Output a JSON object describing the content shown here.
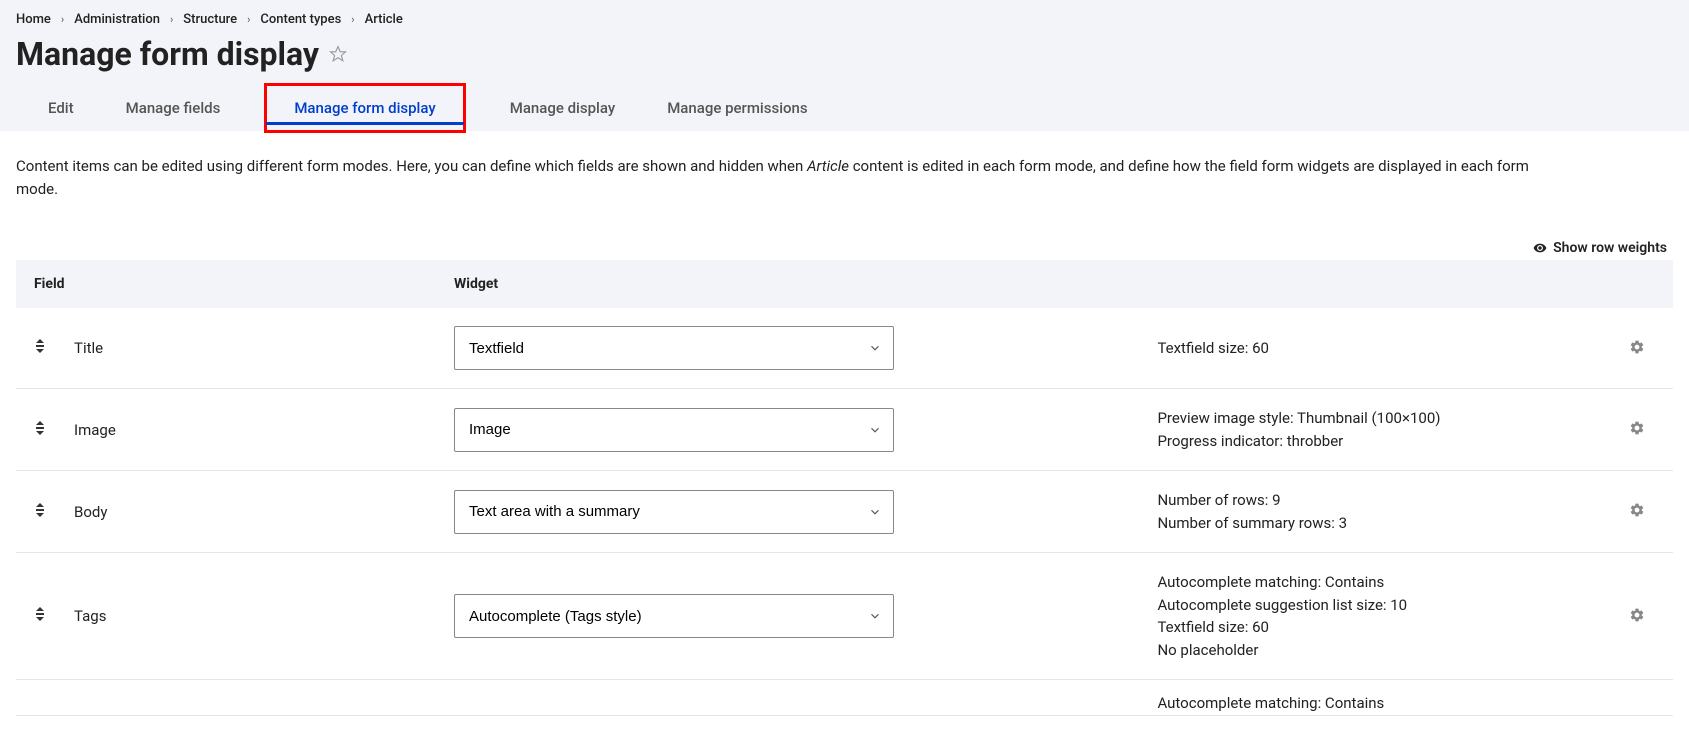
{
  "breadcrumb": [
    "Home",
    "Administration",
    "Structure",
    "Content types",
    "Article"
  ],
  "page_title": "Manage form display",
  "tabs": [
    {
      "label": "Edit",
      "active": false
    },
    {
      "label": "Manage fields",
      "active": false
    },
    {
      "label": "Manage form display",
      "active": true
    },
    {
      "label": "Manage display",
      "active": false
    },
    {
      "label": "Manage permissions",
      "active": false
    }
  ],
  "description_prefix": "Content items can be edited using different form modes. Here, you can define which fields are shown and hidden when ",
  "description_em": "Article",
  "description_suffix": " content is edited in each form mode, and define how the field form widgets are displayed in each form mode.",
  "show_weights_label": "Show row weights",
  "table": {
    "headers": {
      "field": "Field",
      "widget": "Widget"
    },
    "rows": [
      {
        "field": "Title",
        "widget": "Textfield",
        "summary": [
          "Textfield size: 60"
        ]
      },
      {
        "field": "Image",
        "widget": "Image",
        "summary": [
          "Preview image style: Thumbnail (100×100)",
          "Progress indicator: throbber"
        ]
      },
      {
        "field": "Body",
        "widget": "Text area with a summary",
        "summary": [
          "Number of rows: 9",
          "Number of summary rows: 3"
        ]
      },
      {
        "field": "Tags",
        "widget": "Autocomplete (Tags style)",
        "summary": [
          "Autocomplete matching: Contains",
          "Autocomplete suggestion list size: 10",
          "Textfield size: 60",
          "No placeholder"
        ]
      }
    ],
    "partial_row_summary": [
      "Autocomplete matching: Contains"
    ]
  }
}
